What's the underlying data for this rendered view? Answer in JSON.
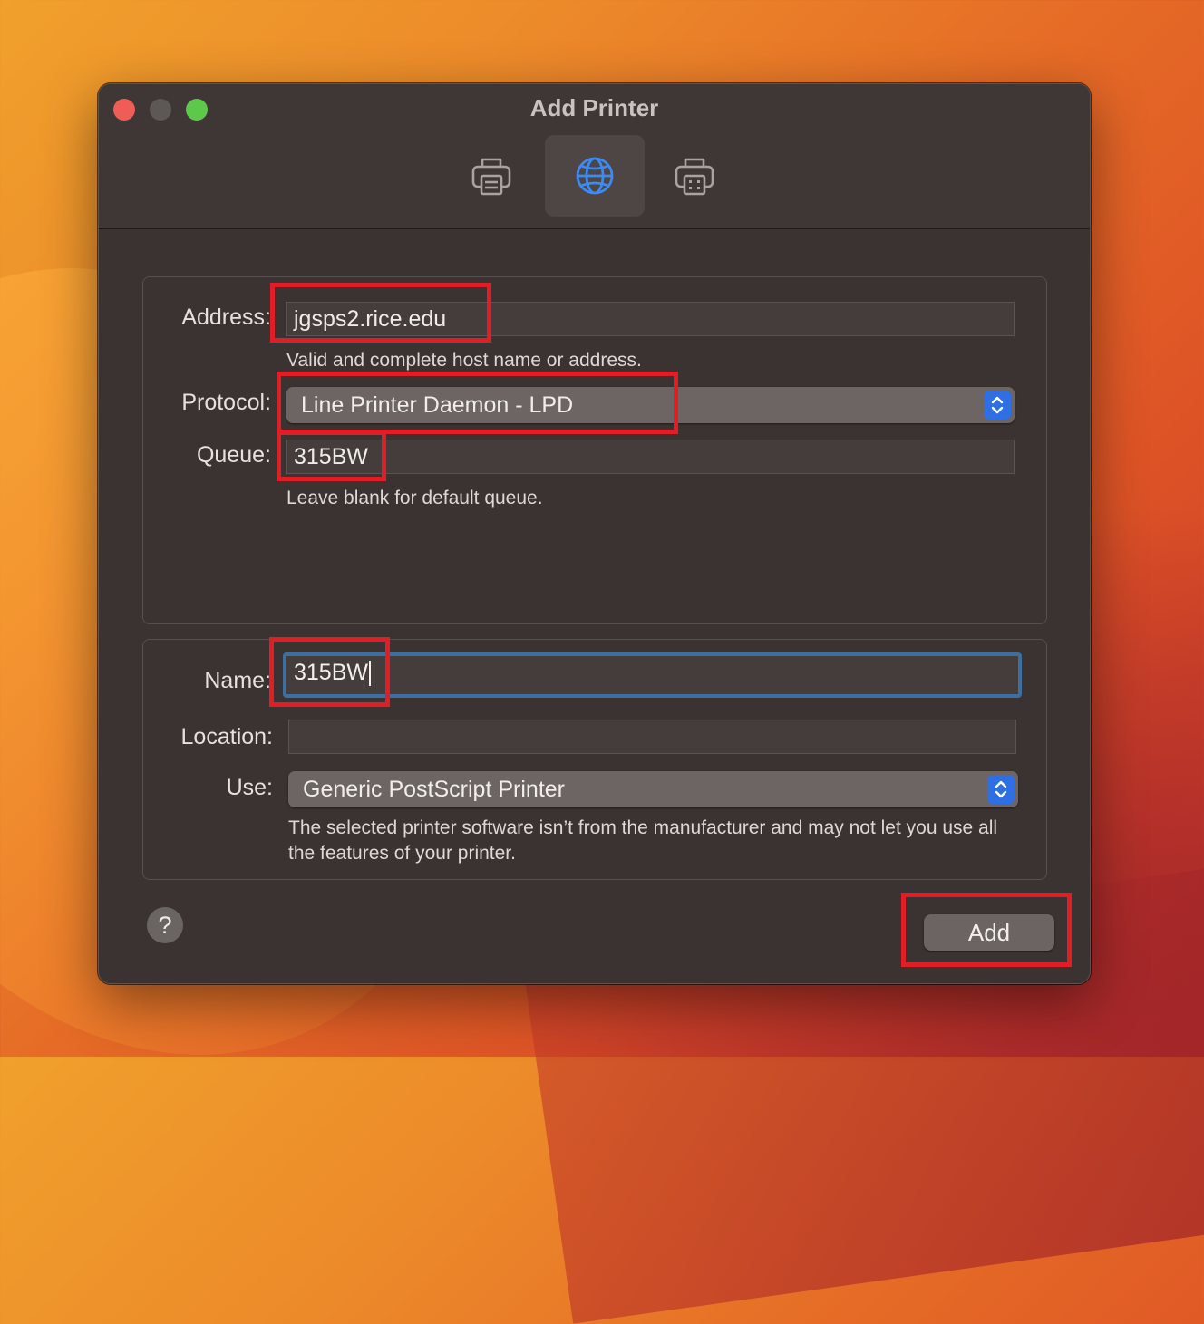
{
  "window": {
    "title": "Add Printer"
  },
  "toolbar": {
    "items": [
      {
        "name": "default",
        "icon": "printer-icon"
      },
      {
        "name": "ip",
        "icon": "globe-icon",
        "selected": true
      },
      {
        "name": "windows",
        "icon": "printer-grid-icon"
      }
    ]
  },
  "connection": {
    "address_label": "Address:",
    "address_value": "jgsps2.rice.edu",
    "address_hint": "Valid and complete host name or address.",
    "protocol_label": "Protocol:",
    "protocol_value": "Line Printer Daemon - LPD",
    "queue_label": "Queue:",
    "queue_value": "315BW",
    "queue_hint": "Leave blank for default queue."
  },
  "details": {
    "name_label": "Name:",
    "name_value": "315BW",
    "location_label": "Location:",
    "location_value": "",
    "use_label": "Use:",
    "use_value": "Generic PostScript Printer",
    "use_warning": "The selected printer software isn’t from the manufacturer and may not let you use all the features of your printer."
  },
  "footer": {
    "help_label": "?",
    "add_label": "Add"
  },
  "colors": {
    "accent": "#2f6fe4",
    "annotation": "#e11d25",
    "focus_ring": "#3f6f9e"
  }
}
